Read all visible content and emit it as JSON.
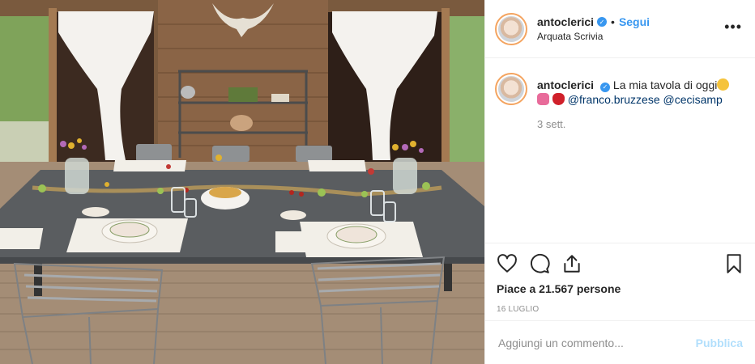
{
  "post": {
    "username": "antoclerici",
    "follow_label": "Segui",
    "dot": "•",
    "location": "Arquata Scrivia",
    "more_label": "•••",
    "caption_text": "La mia tavola di oggi",
    "mention_1": "@franco.bruzzese",
    "mention_2": "@cecisamp",
    "time_ago": "3 sett.",
    "likes": "Piace a 21.567 persone",
    "date": "16 LUGLIO",
    "comment_placeholder": "Aggiungi un commento...",
    "publish_label": "Pubblica"
  },
  "icons": {
    "verified": "verified-badge-icon",
    "like": "heart-icon",
    "comment": "comment-icon",
    "share": "share-icon",
    "save": "bookmark-icon"
  },
  "colors": {
    "link": "#3897f0",
    "mention": "#003569",
    "muted": "#8e8e8e",
    "publish_disabled": "#b2dffc"
  }
}
